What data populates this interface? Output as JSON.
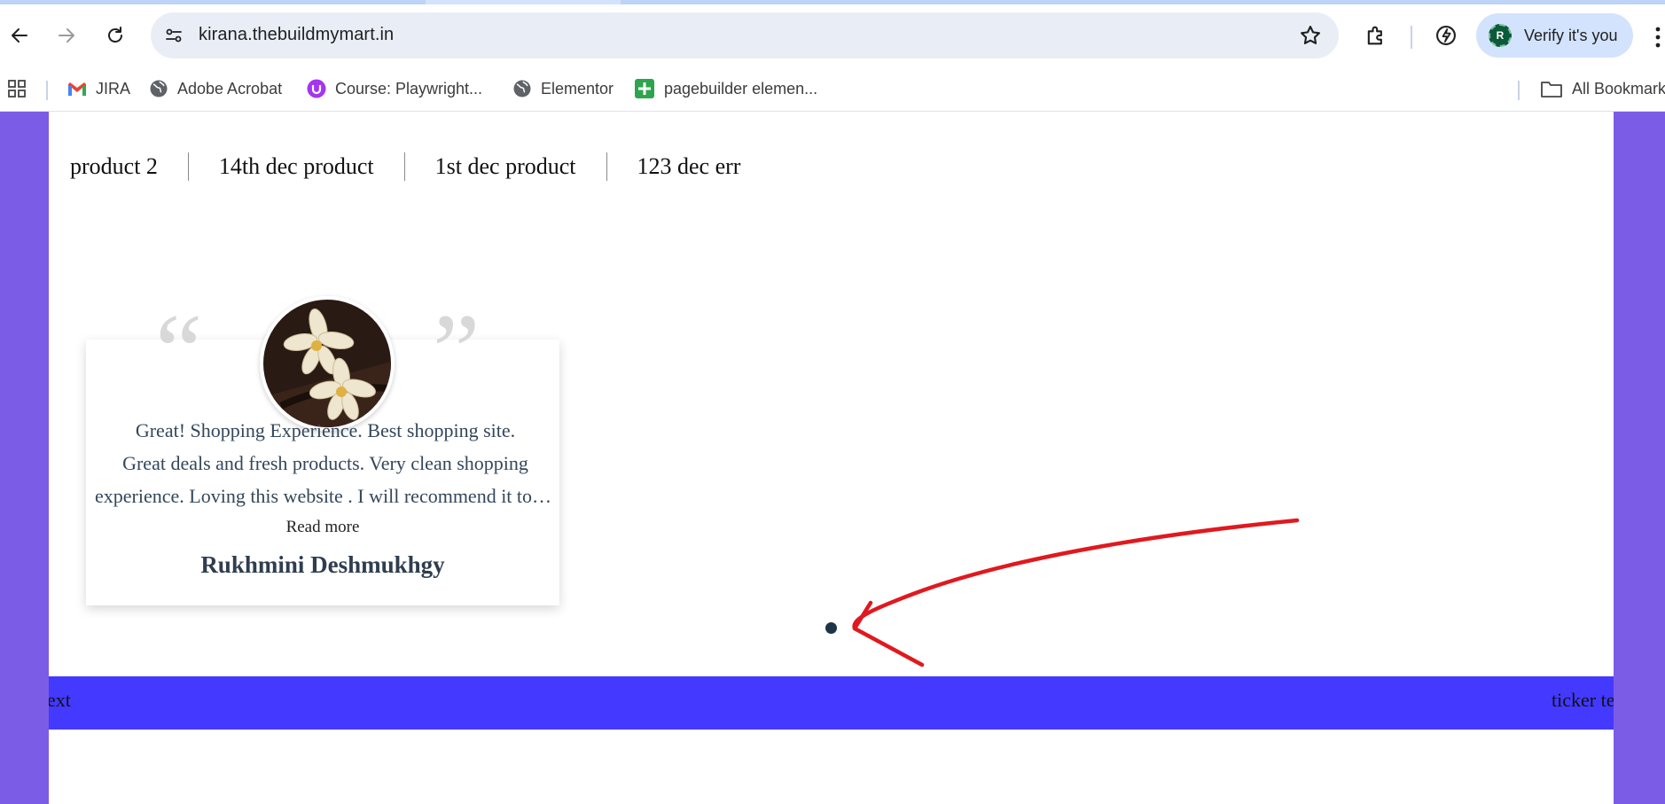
{
  "browser": {
    "url": "kirana.thebuildmymart.in",
    "profile_initial": "R",
    "verify_label": "Verify it's you",
    "bookmarks": [
      "JIRA",
      "Adobe Acrobat",
      "Course: Playwright...",
      "Elementor",
      "pagebuilder elemen..."
    ],
    "all_bookmarks_label": "All Bookmarks"
  },
  "page": {
    "product_nav": [
      "product 2",
      "14th dec product",
      "1st dec product",
      "123 dec err"
    ],
    "testimonial": {
      "text_lines": [
        "Great! Shopping Experience. Best shopping site.",
        "Great deals and fresh products. Very clean shopping",
        "experience. Loving this website . I will recommend it to everyone"
      ],
      "read_more": "Read more",
      "author": "Rukhmini Deshmukhgy"
    },
    "ticker": {
      "left_text": "ext",
      "right_text": "ticker text"
    }
  },
  "colors": {
    "page_side": "#7b5ce6",
    "ticker_bg": "#4439ff",
    "annotation": "#e0191f",
    "omnibox": "#e9eef6"
  }
}
